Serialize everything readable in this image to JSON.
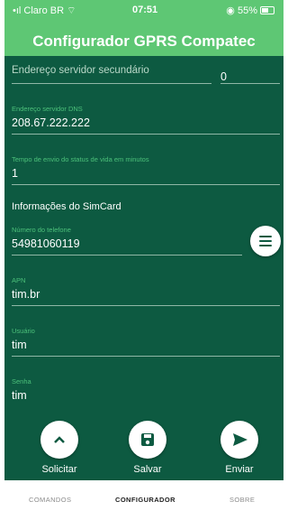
{
  "status": {
    "carrier": "Claro BR",
    "time": "07:51",
    "battery": "55%"
  },
  "title": "Configurador GPRS Compatec",
  "fields": {
    "secondary_server_label": "Endereço servidor secundário",
    "secondary_port_value": "0",
    "dns_label": "Endereço servidor DNS",
    "dns_value": "208.67.222.222",
    "status_interval_label": "Tempo de envio do status de vida em minutos",
    "status_interval_value": "1",
    "simcard_title": "Informações do SimCard",
    "phone_label": "Número do telefone",
    "phone_value": "54981060119",
    "apn_label": "APN",
    "apn_value": "tim.br",
    "user_label": "Usuário",
    "user_value": "tim",
    "password_label": "Senha",
    "password_value": "tim"
  },
  "actions": {
    "request": "Solicitar",
    "save": "Salvar",
    "send": "Enviar"
  },
  "tabs": [
    "COMANDOS",
    "CONFIGURADOR",
    "SOBRE"
  ],
  "colors": {
    "header": "#5ec774",
    "panel": "#0d5a41",
    "label": "#4cc07a"
  },
  "icons": {
    "menu": "menu-icon",
    "request": "chevron-up-icon",
    "save": "save-icon",
    "send": "send-icon"
  }
}
